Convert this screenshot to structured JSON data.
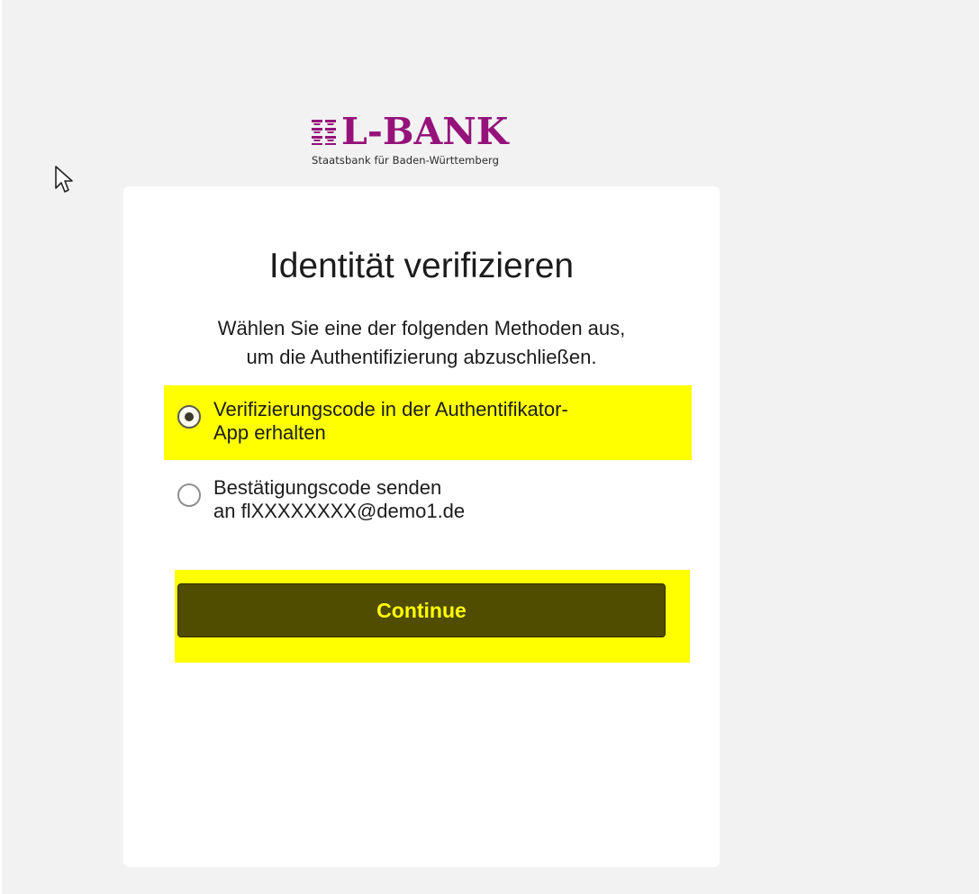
{
  "brand": {
    "name": "L-BANK",
    "tagline": "Staatsbank für Baden-Württemberg",
    "color": "#95127a"
  },
  "page": {
    "title": "Identität verifizieren",
    "subtitle_line1": "Wählen Sie eine der folgenden Methoden aus,",
    "subtitle_line2": "um die Authentifizierung abzuschließen."
  },
  "methods": [
    {
      "line1": "Verifizierungscode in der Authentifikator-",
      "line2": "App erhalten",
      "selected": true
    },
    {
      "line1": "Bestätigungscode senden",
      "line2": "an flXXXXXXXX@demo1.de",
      "selected": false
    }
  ],
  "actions": {
    "continue_label": "Continue"
  },
  "colors": {
    "highlight": "#ffff00",
    "button_bg": "#504c00",
    "button_text": "#ffff00",
    "page_bg": "#f2f2f2"
  },
  "icons": {
    "cursor": "mouse-pointer-icon",
    "logo_mark": "coat-of-arms-icon"
  }
}
